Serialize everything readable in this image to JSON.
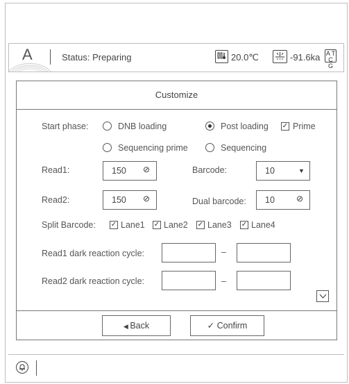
{
  "status": {
    "logo_letter": "A",
    "label": "Status: Preparing",
    "temperature": "20.0℃",
    "pressure": "-91.6ka",
    "cg_badge": [
      "A",
      "T",
      "C",
      "G"
    ],
    "icons": [
      "app-logo",
      "thermometer-icon",
      "pressure-gauge-icon",
      "atcg-badge-icon"
    ]
  },
  "panel": {
    "title": "Customize",
    "start_phase_label": "Start phase:",
    "start_phase_options": [
      {
        "label": "DNB loading",
        "selected": false
      },
      {
        "label": "Post loading",
        "selected": true
      },
      {
        "label": "Sequencing prime",
        "selected": false
      },
      {
        "label": "Sequencing",
        "selected": false
      }
    ],
    "prime_label": "Prime",
    "prime_checked": true,
    "read1_label": "Read1:",
    "read1_value": "150",
    "read2_label": "Read2:",
    "read2_value": "150",
    "barcode_label": "Barcode:",
    "barcode_value": "10",
    "dual_barcode_label": "Dual barcode:",
    "dual_barcode_value": "10",
    "split_barcode_label": "Split Barcode:",
    "lanes": [
      {
        "label": "Lane1",
        "checked": true
      },
      {
        "label": "Lane2",
        "checked": true
      },
      {
        "label": "Lane3",
        "checked": true
      },
      {
        "label": "Lane4",
        "checked": true
      }
    ],
    "read1_dark_label": "Read1 dark reaction cycle:",
    "read2_dark_label": "Read2 dark reaction cycle:",
    "range_dash": "–",
    "back_label": "Back",
    "confirm_label": "Confirm"
  },
  "colors": {
    "border": "#777777",
    "text": "#444444"
  }
}
